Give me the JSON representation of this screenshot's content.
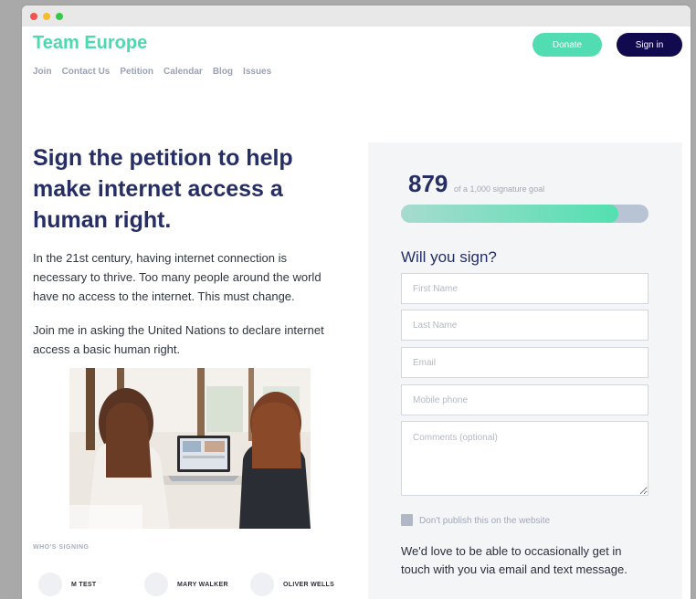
{
  "site": {
    "brand": "Team Europe"
  },
  "nav": [
    "Join",
    "Contact Us",
    "Petition",
    "Calendar",
    "Blog",
    "Issues"
  ],
  "header": {
    "donate_label": "Donate",
    "signin_label": "Sign in"
  },
  "petition": {
    "headline": "Sign the petition to help make internet access a human right.",
    "paragraphs": [
      "In the 21st century, having internet connection is necessary to thrive. Too many people around the world have no access to the internet. This must change.",
      "Join me in asking the United Nations to declare internet access a basic human right."
    ]
  },
  "signers": {
    "label": "WHO'S SIGNING",
    "names": [
      "M TEST",
      "MARY WALKER",
      "OLIVER WELLS"
    ]
  },
  "form": {
    "count": "879",
    "goal_text": "of a 1,000 signature goal",
    "progress_fraction": 0.879,
    "title": "Will you sign?",
    "fields": {
      "first_name": "First Name",
      "last_name": "Last Name",
      "email": "Email",
      "mobile": "Mobile phone",
      "comments": "Comments (optional)"
    },
    "dont_publish": "Don't publish this on the website",
    "contact_text": "We'd love to be able to occasionally get in touch with you via email and text message."
  },
  "colors": {
    "brand": "#4bd9b0",
    "donate": "#52dcb1",
    "signin": "#120a4f",
    "heading": "#262e66",
    "progress_track": "#b8c3d3"
  },
  "icons": [
    "window-close-dot",
    "window-minimize-dot",
    "window-maximize-dot"
  ]
}
